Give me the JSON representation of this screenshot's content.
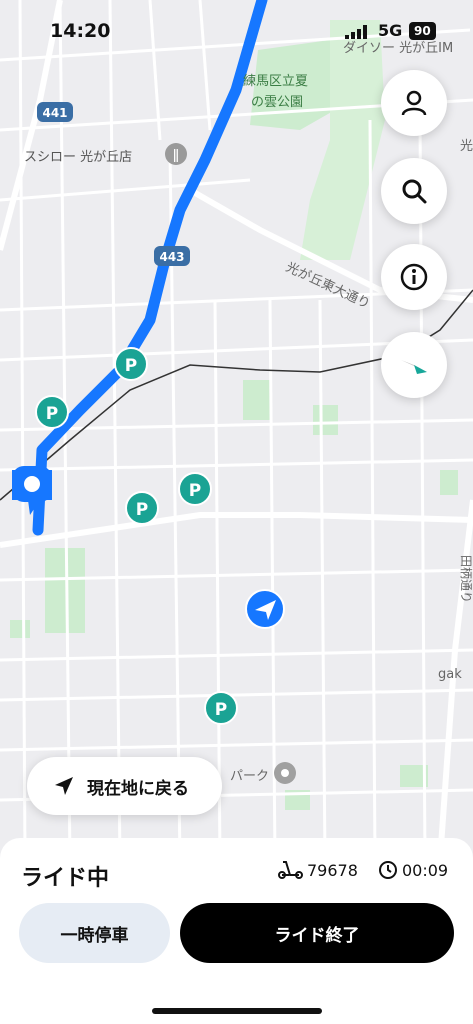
{
  "status_bar": {
    "time": "14:20",
    "network": "5G",
    "battery": "90"
  },
  "map": {
    "labels": {
      "park": "練馬区立夏\nの雲公園",
      "daiso": "ダイソー 光が丘IM",
      "sushiro": "スシロー 光が丘店",
      "road_441": "441",
      "road_443": "443",
      "hikarigaoka_east": "光が丘東大通り",
      "tagara": "田柄通り",
      "gak": "gak",
      "park2": "パーク",
      "hikari_edge": "光"
    },
    "parking_icon_label": "P",
    "colors": {
      "route": "#1677ff",
      "parking": "#1aa394",
      "park_green": "#cdeccf",
      "user_location": "#1677ff"
    }
  },
  "right_buttons": [
    {
      "icon": "person-icon"
    },
    {
      "icon": "search-icon"
    },
    {
      "icon": "info-icon"
    },
    {
      "icon": "compass-icon"
    }
  ],
  "return_button": {
    "label": "現在地に戻る",
    "icon": "navigation-arrow-icon"
  },
  "ride_panel": {
    "title": "ライド中",
    "scooter_id": "79678",
    "elapsed": "00:09",
    "pause_label": "一時停車",
    "end_label": "ライド終了"
  }
}
